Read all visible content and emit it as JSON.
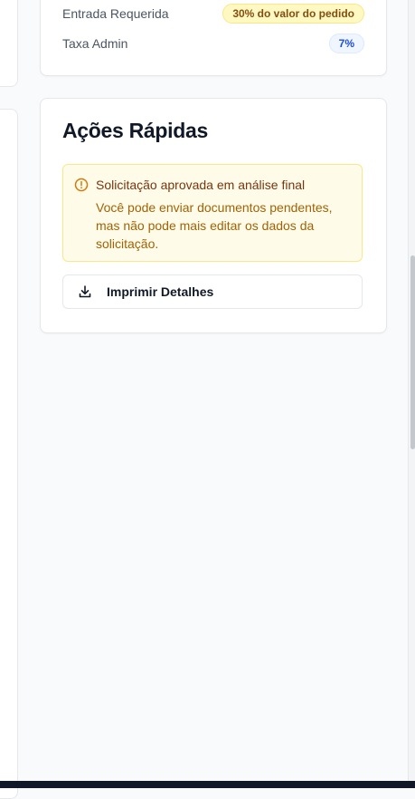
{
  "summary": {
    "rows": [
      {
        "label": "Entrada Requerida",
        "badge": "30% do valor do pedido"
      },
      {
        "label": "Taxa Admin",
        "badge": "7%"
      }
    ]
  },
  "actions": {
    "title": "Ações Rápidas",
    "alert": {
      "icon": "alert-circle-icon",
      "title": "Solicitação aprovada em análise final",
      "body": "Você pode enviar documentos pendentes, mas não pode mais editar os dados da solicitação."
    },
    "print_button": {
      "icon": "download-icon",
      "label": "Imprimir Detalhes"
    }
  },
  "colors": {
    "warning_bg": "#fefce8",
    "warning_border": "#fde68a",
    "warning_text": "#a16207",
    "badge_blue_text": "#1d4ed8"
  }
}
